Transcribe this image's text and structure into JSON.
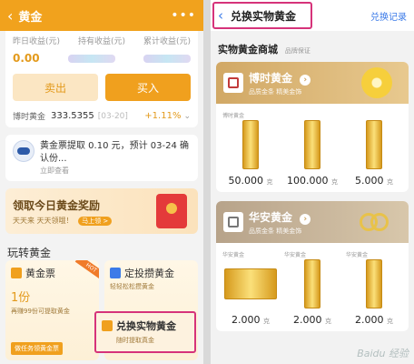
{
  "left": {
    "header": {
      "back": "‹",
      "title": "黄金",
      "more": "•••"
    },
    "stats": {
      "labels": [
        "昨日收益(元)",
        "持有收益(元)",
        "累计收益(元)"
      ],
      "value0": "0.00"
    },
    "buttons": {
      "sell": "卖出",
      "buy": "买入"
    },
    "price": {
      "label": "博时黄金",
      "value": "333.5355",
      "date": "[03-20]",
      "change": "+1.11%",
      "chevron": "⌄"
    },
    "notice": {
      "text": "黄金票提取 0.10 元，预计 03-24 确认份...",
      "sub": "立即查看"
    },
    "promo": {
      "title": "领取今日黄金奖励",
      "sub": "天天来 天天领哦！",
      "badge": "马上领 >"
    },
    "section_title": "玩转黄金",
    "cards": {
      "ticket": {
        "title": "黄金票",
        "badge": "HOT",
        "amount": "1份",
        "desc": "再赚99份可提取黄金",
        "button": "做任务领黄金票"
      },
      "invest": {
        "title": "定投攒黄金",
        "desc": "轻轻松松攒黄金"
      },
      "redeem": {
        "title": "兑换实物黄金",
        "desc": "随时提取真金"
      }
    }
  },
  "right": {
    "header": {
      "back": "‹",
      "title": "兑换实物黄金",
      "link": "兑换记录"
    },
    "shop": {
      "title": "实物黄金商城",
      "tag": "品牌保证"
    },
    "brands": [
      {
        "name": "博时黄金",
        "sub": "品质金条 精美金饰",
        "products": [
          {
            "brand": "博时黄金",
            "weight": "50.000",
            "unit": "克"
          },
          {
            "brand": "",
            "weight": "100.000",
            "unit": "克"
          },
          {
            "brand": "",
            "weight": "5.000",
            "unit": "克"
          }
        ]
      },
      {
        "name": "华安黄金",
        "sub": "品质金条 精美金饰",
        "products": [
          {
            "brand": "华安黄金",
            "weight": "2.000",
            "unit": "克"
          },
          {
            "brand": "华安黄金",
            "weight": "2.000",
            "unit": "克"
          },
          {
            "brand": "华安黄金",
            "weight": "2.000",
            "unit": "克"
          }
        ]
      }
    ],
    "watermark": "Baidu 经验"
  },
  "colors": {
    "accent": "#f0a01e",
    "highlight_box": "#d6337a",
    "link": "#3c7be8"
  }
}
